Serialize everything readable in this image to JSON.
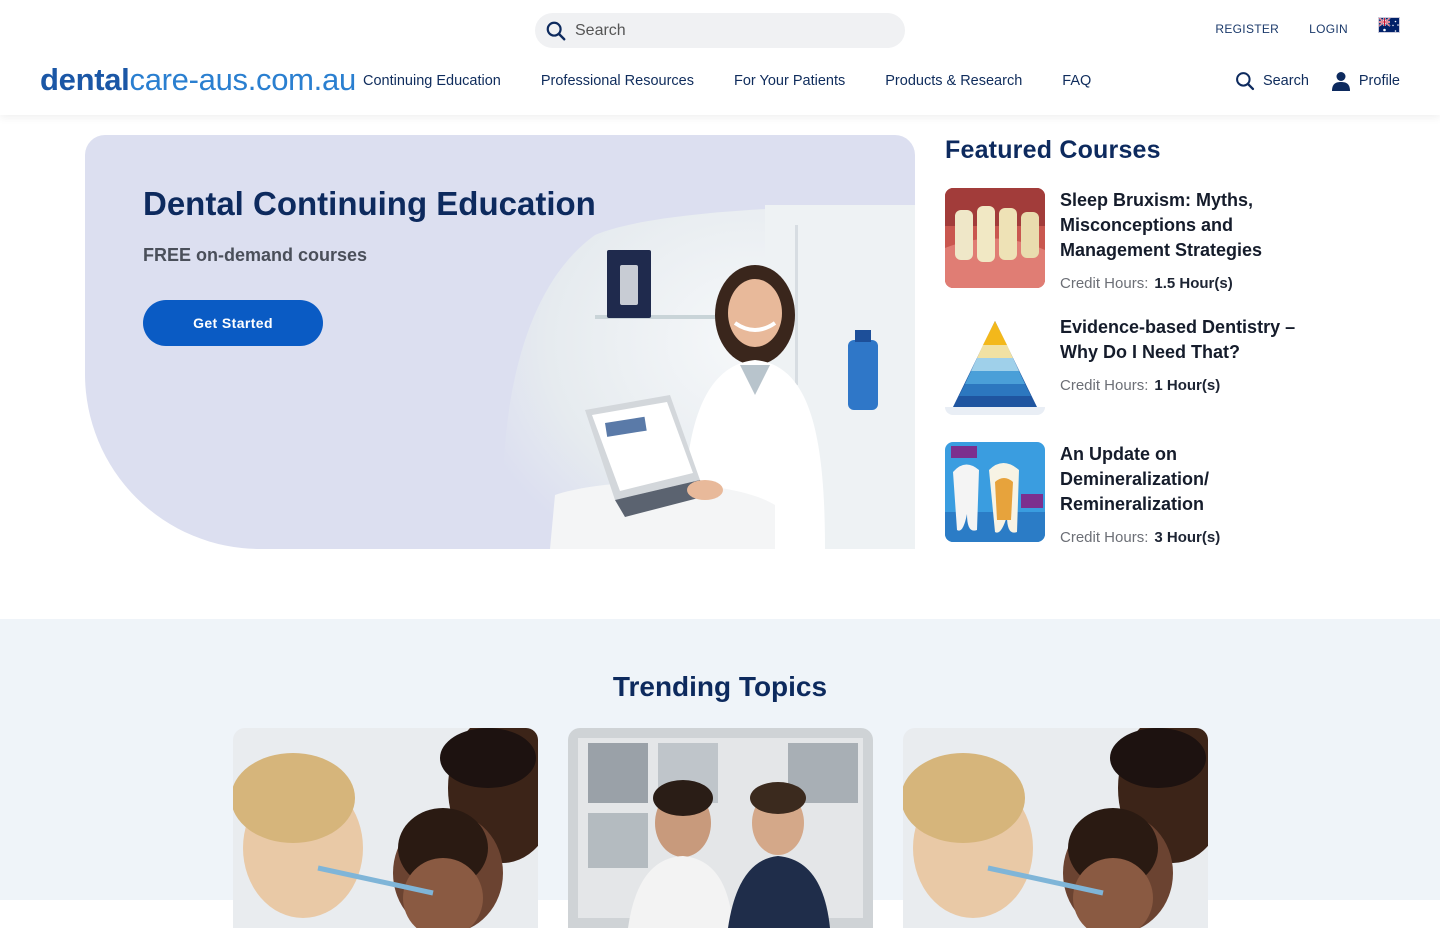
{
  "header": {
    "search_placeholder": "Search",
    "register": "REGISTER",
    "login": "LOGIN",
    "logo_bold": "dental",
    "logo_light": "care-aus.com.au",
    "nav": [
      "Continuing Education",
      "Professional Resources",
      "For Your Patients",
      "Products & Research",
      "FAQ"
    ],
    "util_search": "Search",
    "util_profile": "Profile",
    "brand_color": "#0a5bc4"
  },
  "hero": {
    "title": "Dental Continuing Education",
    "subtitle": "FREE on-demand courses",
    "cta": "Get Started",
    "background": "#dcdff0"
  },
  "featured": {
    "heading": "Featured Courses",
    "credit_label": "Credit Hours:",
    "courses": [
      {
        "title": "Sleep Bruxism: Myths, Misconceptions and Management Strategies",
        "hours": "1.5 Hour(s)"
      },
      {
        "title": "Evidence-based Dentistry – Why Do I Need That?",
        "hours": "1 Hour(s)"
      },
      {
        "title": "An Update on Demineralization/ Remineralization",
        "hours": "3 Hour(s)"
      }
    ]
  },
  "trending": {
    "heading": "Trending Topics"
  }
}
